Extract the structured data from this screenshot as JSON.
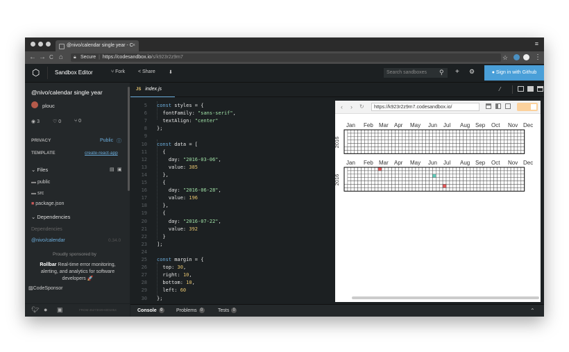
{
  "browser": {
    "tab_title": "@nivo/calendar single year - C",
    "tab_close": "×",
    "url_secure": "Secure",
    "url_sep": "|",
    "url_host": "https://codesandbox.io",
    "url_path": "/s/k923r2z9m7",
    "back_icon": "←",
    "forward_icon": "→",
    "reload_icon": "C",
    "home_icon": "⌂",
    "star_icon": "☆",
    "menu_icon": "⋮",
    "incognito_icon": "≡"
  },
  "app": {
    "title": "Sandbox Editor",
    "fork_label": "Fork",
    "share_label": "Share",
    "download_icon": "⬇",
    "search_placeholder": "Search sandboxes",
    "search_icon": "⚲",
    "add_icon": "+",
    "settings_icon": "⚙",
    "signin_label": "Sign in with Github"
  },
  "sidebar": {
    "sandbox_title": "@nivo/calendar single year",
    "author": "plouc",
    "views": "3",
    "likes": "0",
    "forks": "0",
    "privacy_label": "PRIVACY",
    "privacy_value": "Public",
    "template_label": "TEMPLATE",
    "template_value": "create-react-app",
    "files_label": "Files",
    "files": [
      {
        "name": "public",
        "type": "folder"
      },
      {
        "name": "src",
        "type": "folder"
      },
      {
        "name": "package.json",
        "type": "json"
      }
    ],
    "dependencies_label": "Dependencies",
    "dependencies_sub": "Dependencies",
    "dependency_name": "@nivo/calendar",
    "dependency_version": "0.34.0",
    "sponsor_title": "Proudly sponsored by",
    "sponsor_brand": "Rollbar",
    "sponsor_text": " Real-time error monitoring, alerting, and analytics for software developers 🚀",
    "codesponsor_alt": "CodeSponsor",
    "footer_hash": "FROM-45273049-6001054"
  },
  "editor": {
    "tab_badge": "JS",
    "tab_label": "index.js",
    "lines": [
      {
        "n": "5",
        "html": "<span class=\"kw\">const</span> styles = {"
      },
      {
        "n": "6",
        "html": "  fontFamily: <span class=\"str\">\"sans-serif\"</span>,"
      },
      {
        "n": "7",
        "html": "  textAlign: <span class=\"str\">\"center\"</span>"
      },
      {
        "n": "8",
        "html": "};"
      },
      {
        "n": "9",
        "html": ""
      },
      {
        "n": "10",
        "html": "<span class=\"kw\">const</span> data = ["
      },
      {
        "n": "11",
        "html": "  {"
      },
      {
        "n": "12",
        "html": "    day: <span class=\"str\">\"2016-03-06\"</span>,"
      },
      {
        "n": "13",
        "html": "    value: <span class=\"num\">385</span>"
      },
      {
        "n": "14",
        "html": "  },"
      },
      {
        "n": "15",
        "html": "  {"
      },
      {
        "n": "16",
        "html": "    day: <span class=\"str\">\"2016-06-28\"</span>,"
      },
      {
        "n": "17",
        "html": "    value: <span class=\"num\">196</span>"
      },
      {
        "n": "18",
        "html": "  },"
      },
      {
        "n": "19",
        "html": "  {"
      },
      {
        "n": "20",
        "html": "    day: <span class=\"str\">\"2016-07-22\"</span>,"
      },
      {
        "n": "21",
        "html": "    value: <span class=\"num\">392</span>"
      },
      {
        "n": "22",
        "html": "  }"
      },
      {
        "n": "23",
        "html": "];"
      },
      {
        "n": "24",
        "html": ""
      },
      {
        "n": "25",
        "html": "<span class=\"kw\">const</span> margin = {"
      },
      {
        "n": "26",
        "html": "  top: <span class=\"num\">30</span>,"
      },
      {
        "n": "27",
        "html": "  right: <span class=\"num\">10</span>,"
      },
      {
        "n": "28",
        "html": "  bottom: <span class=\"num\">10</span>,"
      },
      {
        "n": "29",
        "html": "  left: <span class=\"num\">60</span>"
      },
      {
        "n": "30",
        "html": "};"
      }
    ]
  },
  "preview": {
    "url": "https://k923r2z9m7.codesandbox.io/",
    "calendar": {
      "year_label": "2016",
      "months": [
        "Jan",
        "Feb",
        "Mar",
        "Apr",
        "May",
        "Jun",
        "Jul",
        "Aug",
        "Sep",
        "Oct",
        "Nov",
        "Dec"
      ],
      "grid_color": "#000000",
      "highlights_chart2": [
        {
          "day": "2016-03-06",
          "color": "#e8595a"
        },
        {
          "day": "2016-06-28",
          "color": "#61cdbb"
        },
        {
          "day": "2016-07-22",
          "color": "#e8595a"
        }
      ]
    }
  },
  "bottom": {
    "console_label": "Console",
    "console_count": "0",
    "problems_label": "Problems",
    "problems_count": "0",
    "tests_label": "Tests",
    "tests_count": "0",
    "collapse_icon": "⌃"
  },
  "colors": {
    "accent": "#6caedd",
    "signin": "#4a9fd8",
    "toggle": "#fcd19c"
  }
}
